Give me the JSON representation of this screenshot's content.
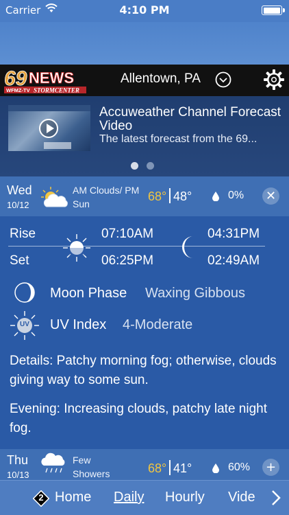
{
  "status_bar": {
    "carrier": "Carrier",
    "time": "4:10 PM"
  },
  "header": {
    "logo_text": "69NEWS",
    "logo_sub": "WFMZ-TV STORMCENTER",
    "location": "Allentown, PA"
  },
  "video": {
    "title": "Accuweather Channel Forecast Video",
    "subtitle": "The latest forecast from the 69...",
    "pages": 2,
    "active_page": 1
  },
  "today": {
    "day": "Wed",
    "date": "10/12",
    "condition": "AM Clouds/ PM Sun",
    "high": "68°",
    "low": "48°",
    "precip": "0%",
    "toggle_symbol": "✕"
  },
  "detail": {
    "rise_label": "Rise",
    "set_label": "Set",
    "sunrise": "07:10AM",
    "sunset": "06:25PM",
    "moonrise": "04:31PM",
    "moonset": "02:49AM",
    "moon_phase_label": "Moon Phase",
    "moon_phase_value": "Waxing Gibbous",
    "uv_label": "UV Index",
    "uv_value": "4-Moderate",
    "uv_icon_text": "UV",
    "details": "Details: Patchy morning fog; otherwise, clouds giving way to some sun.",
    "evening": "Evening: Increasing clouds, patchy late night fog."
  },
  "next_day": {
    "day": "Thu",
    "date": "10/13",
    "condition": "Few Showers",
    "high": "68°",
    "low": "41°",
    "precip": "60%",
    "toggle_symbol": "+"
  },
  "bottom_nav": {
    "badge": "2",
    "items": [
      "Home",
      "Daily",
      "Hourly",
      "Vide"
    ],
    "active": "Daily"
  },
  "colors": {
    "accent_temp": "#f2c640",
    "panel": "#2a5aa6",
    "row": "#3f6fb4",
    "header": "#111111"
  }
}
